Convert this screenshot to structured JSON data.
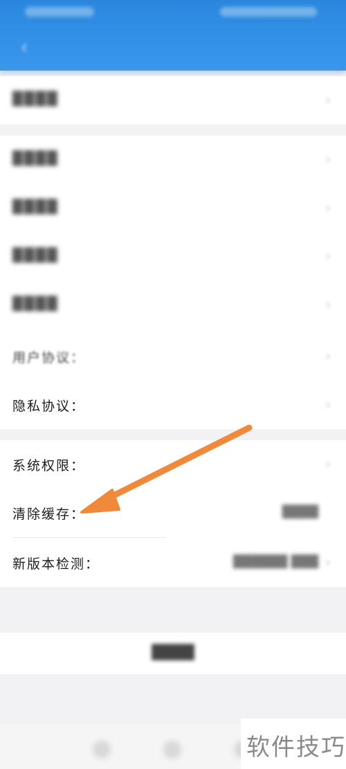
{
  "nav": {
    "back_icon": "back-arrow-icon",
    "title": "",
    "right_action": ""
  },
  "rows": {
    "user_agreement": "用户协议：",
    "privacy_agreement": "隐私协议：",
    "system_permissions": "系统权限：",
    "clear_cache": "清除缓存：",
    "new_version_check": "新版本检测："
  },
  "annotation": {
    "arrow_color": "#f08a3a",
    "target": "清除缓存"
  },
  "watermark": {
    "text": "软件技巧"
  },
  "colors": {
    "header": "#2f8ee4",
    "background": "#f2f2f4",
    "card": "#ffffff"
  }
}
